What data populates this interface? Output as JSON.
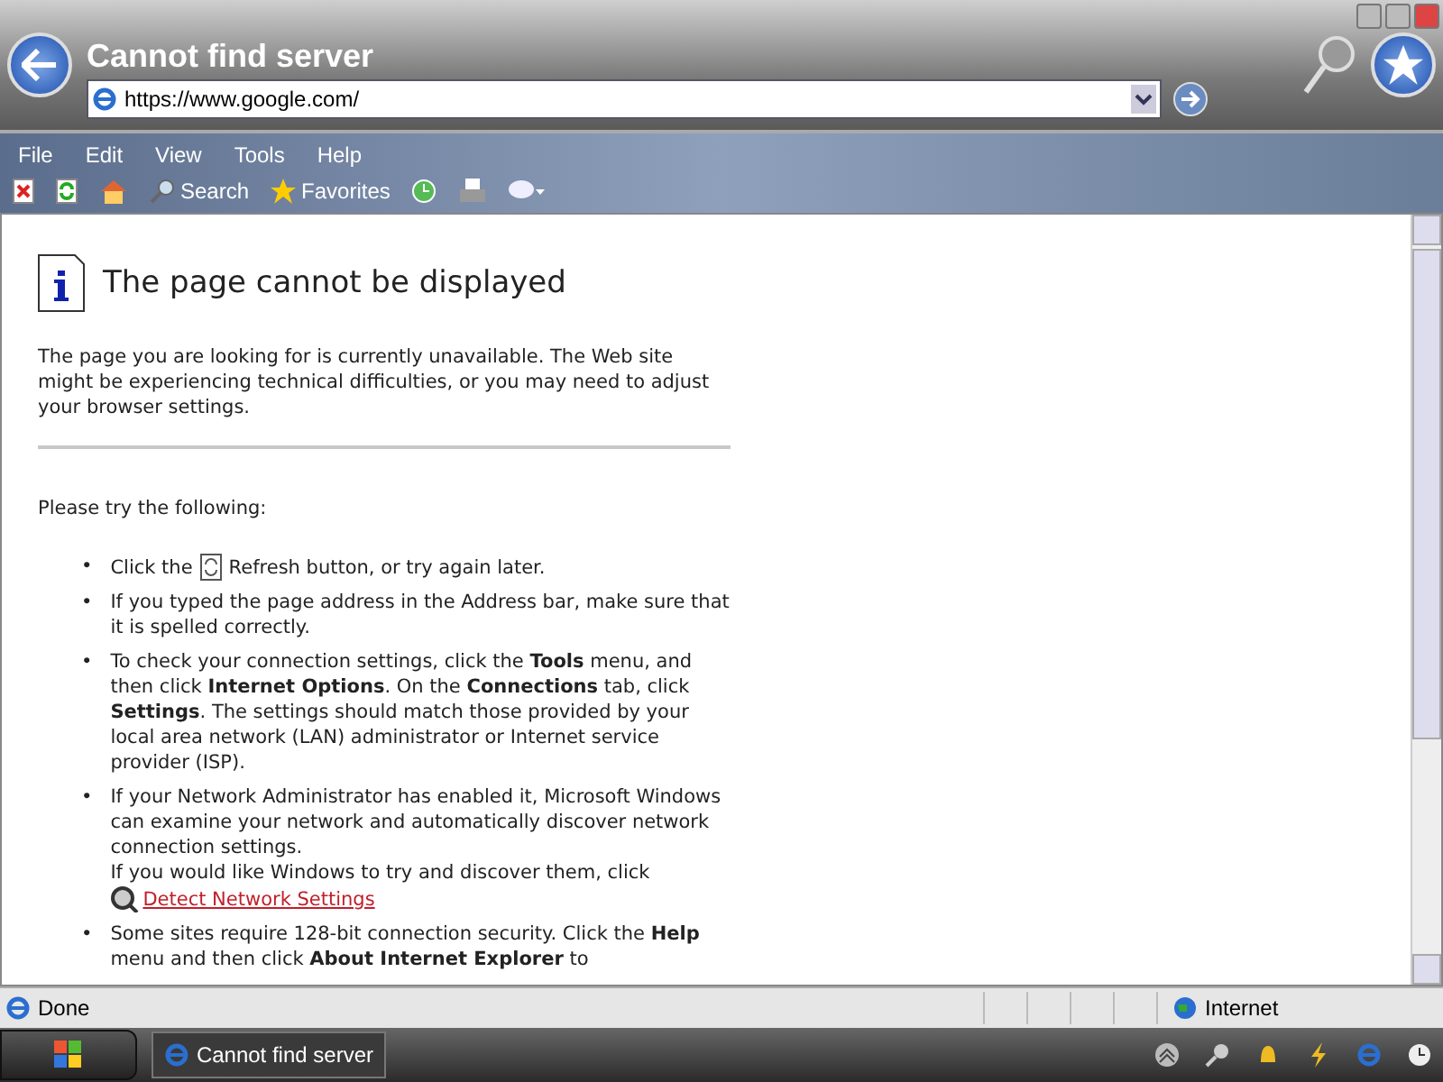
{
  "window": {
    "title": "Cannot find server",
    "address": "https://www.google.com/"
  },
  "menu": [
    "File",
    "Edit",
    "View",
    "Tools",
    "Help"
  ],
  "toolbar": [
    {
      "kind": "stop"
    },
    {
      "kind": "refresh"
    },
    {
      "kind": "home"
    },
    {
      "kind": "search",
      "label": "Search"
    },
    {
      "kind": "favorites",
      "label": "Favorites"
    },
    {
      "kind": "history"
    },
    {
      "kind": "print"
    },
    {
      "kind": "messenger"
    }
  ],
  "page": {
    "heading": "The page cannot be displayed",
    "intro": "The page you are looking for is currently unavailable. The Web site might be experiencing technical difficulties, or you may need to adjust your browser settings.",
    "try_label": "Please try the following:",
    "bullets": [
      {
        "bullet": "•",
        "before": "Click the",
        "after": "Refresh button, or try again later."
      },
      {
        "bullet": "•",
        "text": "If you typed the page address in the Address bar, make sure that it is spelled correctly."
      },
      {
        "bullet": "•",
        "text": "To check your connection settings, click the **Tools** menu, and then click **Internet Options**. On the **Connections** tab, click **Settings**. The settings should match those provided by your local area network (LAN) administrator or Internet service provider (ISP)."
      },
      {
        "bullet": "•",
        "text": "If your Network Administrator has enabled it, Microsoft Windows can examine your network and automatically discover network connection settings.",
        "extra": "If you would like Windows to try and discover them, click",
        "link": "Detect Network Settings"
      },
      {
        "bullet": "•",
        "text": "Some sites require 128-bit connection security. Click the **Help** menu and then click **About Internet Explorer** to"
      }
    ]
  },
  "status_bar": {
    "text": "Done",
    "zone": "Internet"
  },
  "taskbar": {
    "task": "Cannot find server"
  }
}
